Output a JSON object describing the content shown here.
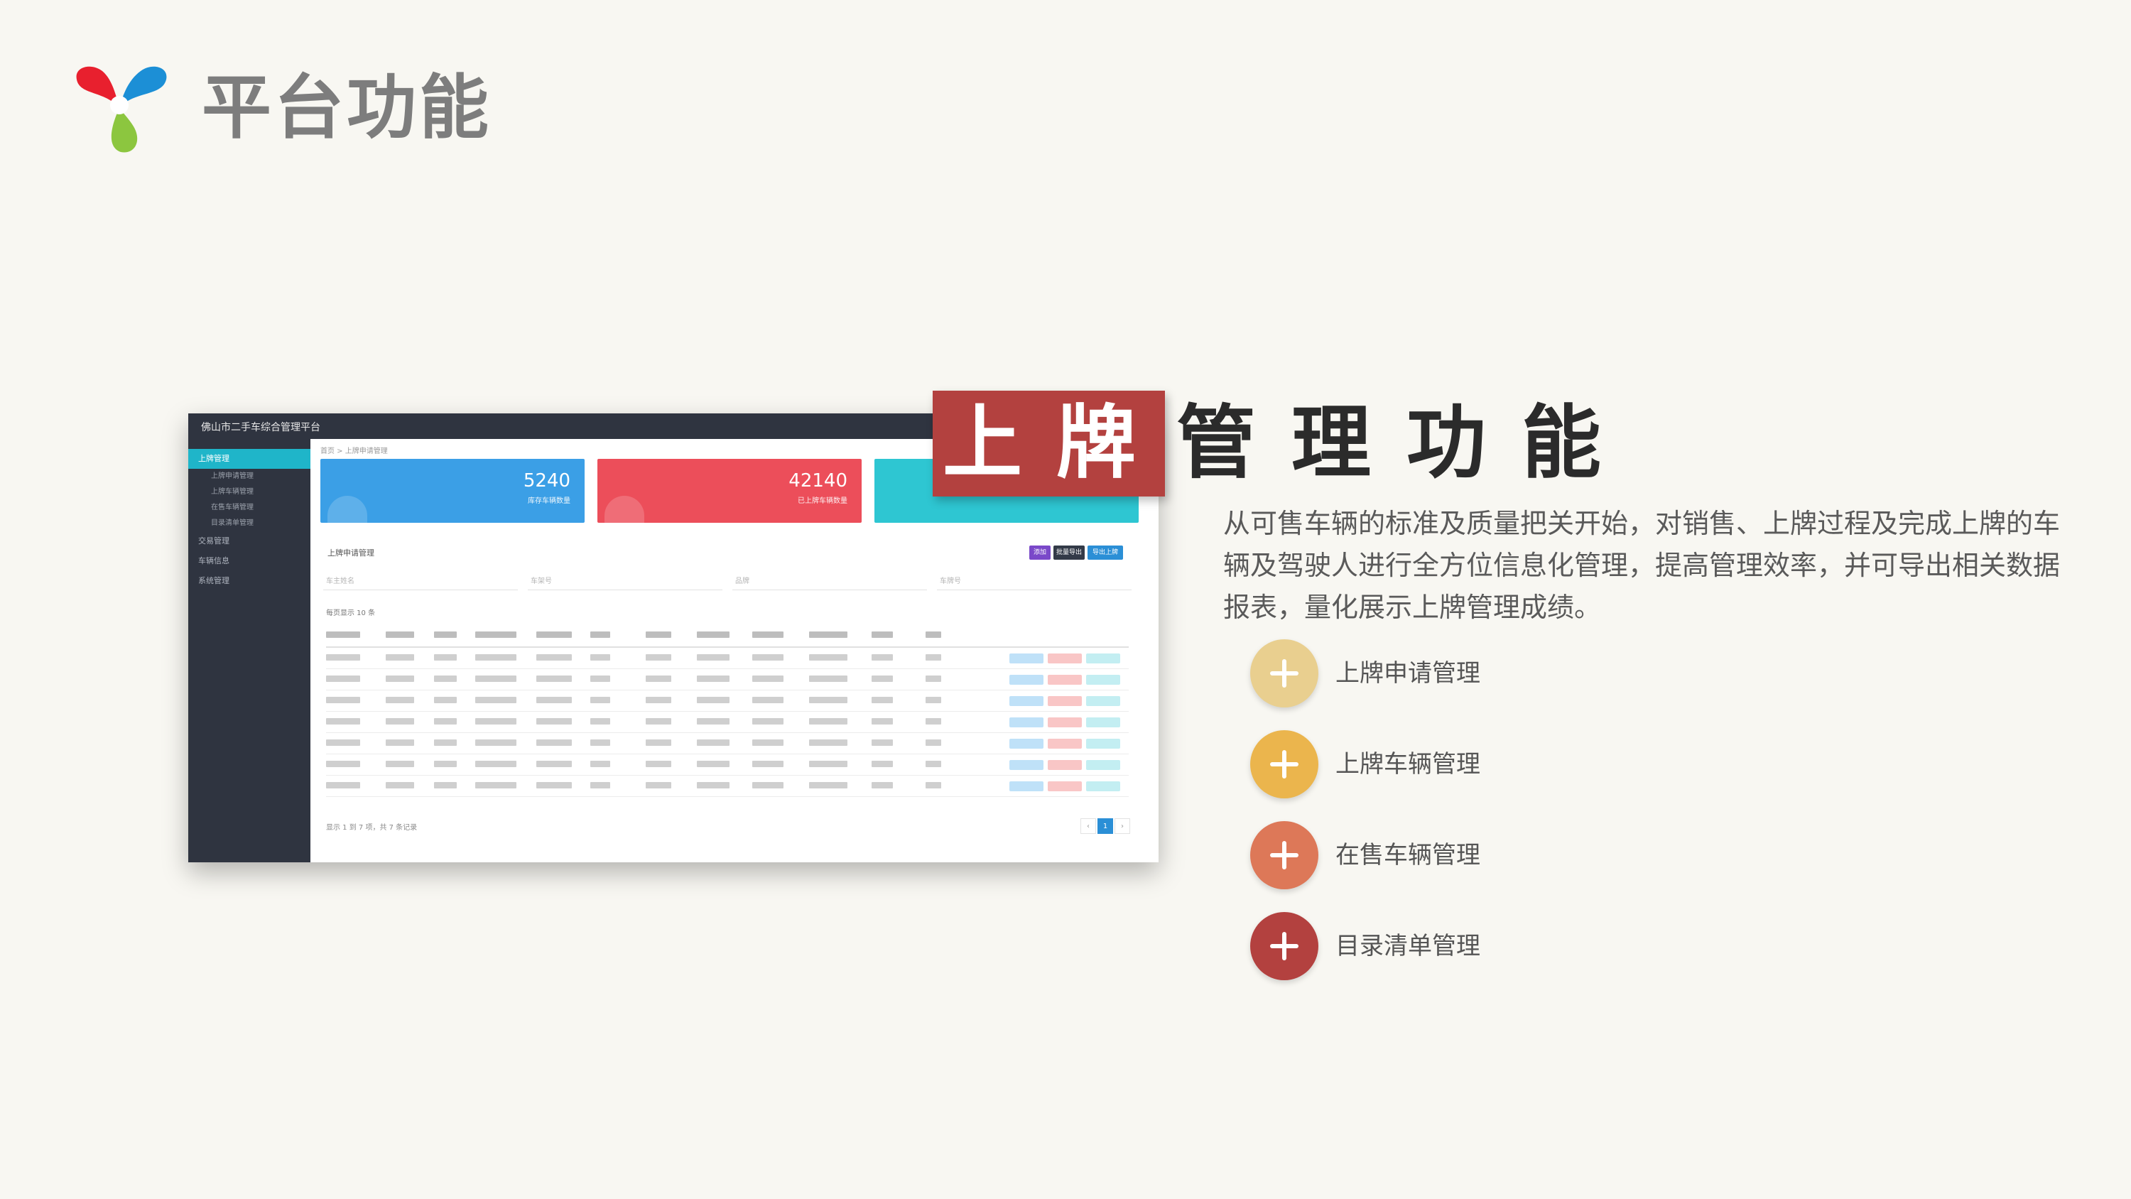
{
  "page": {
    "title": "平台功能",
    "logo_icon": "tri-color-y-logo-icon"
  },
  "screenshot": {
    "app_title": "佛山市二手车综合管理平台",
    "breadcrumb": "首页 > 上牌申请管理",
    "sidebar": [
      {
        "label": "上牌管理",
        "active": true
      },
      {
        "label": "上牌申请管理",
        "sub": true
      },
      {
        "label": "上牌车辆管理",
        "sub": true
      },
      {
        "label": "在售车辆管理",
        "sub": true
      },
      {
        "label": "目录清单管理",
        "sub": true
      },
      {
        "label": "交易管理"
      },
      {
        "label": "车辆信息"
      },
      {
        "label": "系统管理"
      }
    ],
    "cards": [
      {
        "value": "5240",
        "label": "库存车辆数量",
        "color": "#3b9fe6"
      },
      {
        "value": "42140",
        "label": "已上牌车辆数量",
        "color": "#ec4e5a"
      },
      {
        "value": "",
        "label": "",
        "color": "#2ec6d2"
      }
    ],
    "section_title": "上牌申请管理",
    "buttons": [
      "添加",
      "批量导出",
      "导出上牌"
    ],
    "filters": [
      "车主姓名",
      "车架号",
      "品牌",
      "车牌号"
    ],
    "per_page": "每页显示 10 条",
    "rows": 7,
    "footer": "显示 1 到 7 项，共 7 条记录",
    "pagination": [
      "‹",
      "1",
      "›"
    ]
  },
  "heading": {
    "highlight": "上牌",
    "rest": "管理功能"
  },
  "description": "从可售车辆的标准及质量把关开始，对销售、上牌过程及完成上牌的车辆及驾驶人进行全方位信息化管理，提高管理效率，并可导出相关数据报表，量化展示上牌管理成绩。",
  "features": [
    {
      "label": "上牌申请管理",
      "color": "#e9cf8f",
      "icon": "plus-icon"
    },
    {
      "label": "上牌车辆管理",
      "color": "#ebb54d",
      "icon": "plus-icon"
    },
    {
      "label": "在售车辆管理",
      "color": "#dd7858",
      "icon": "plus-icon"
    },
    {
      "label": "目录清单管理",
      "color": "#b3413f",
      "icon": "plus-icon"
    }
  ]
}
